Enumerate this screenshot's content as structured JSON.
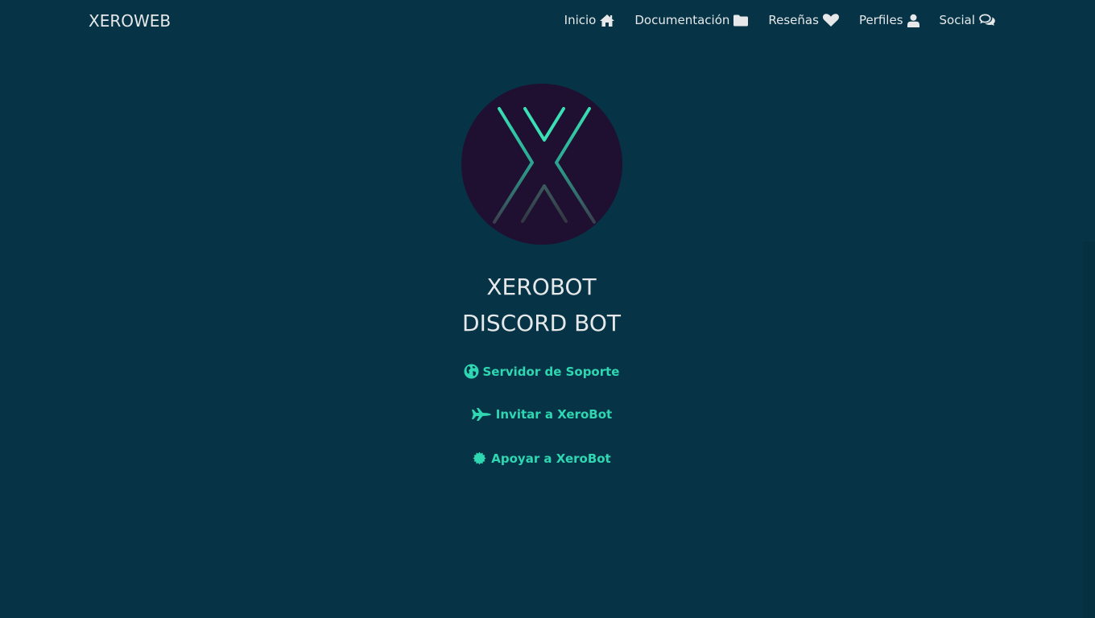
{
  "navbar": {
    "brand": "XEROWEB",
    "items": [
      {
        "label": "Inicio",
        "icon": "home-icon"
      },
      {
        "label": "Documentación",
        "icon": "folder-icon"
      },
      {
        "label": "Reseñas",
        "icon": "heart-icon"
      },
      {
        "label": "Perfiles",
        "icon": "user-icon"
      },
      {
        "label": "Social",
        "icon": "comments-icon"
      }
    ]
  },
  "hero": {
    "title_line1": "XEROBOT",
    "title_line2": "DISCORD BOT",
    "links": [
      {
        "label": "Servidor de Soporte",
        "icon": "globe-icon"
      },
      {
        "label": "Invitar a XeroBot",
        "icon": "fighter-jet-icon"
      },
      {
        "label": "Apoyar a XeroBot",
        "icon": "badge-icon"
      }
    ]
  },
  "colors": {
    "background": "#063446",
    "accent": "#2fd6b2",
    "text": "#e6e8ea",
    "logo_circle": "#1f0f30"
  }
}
